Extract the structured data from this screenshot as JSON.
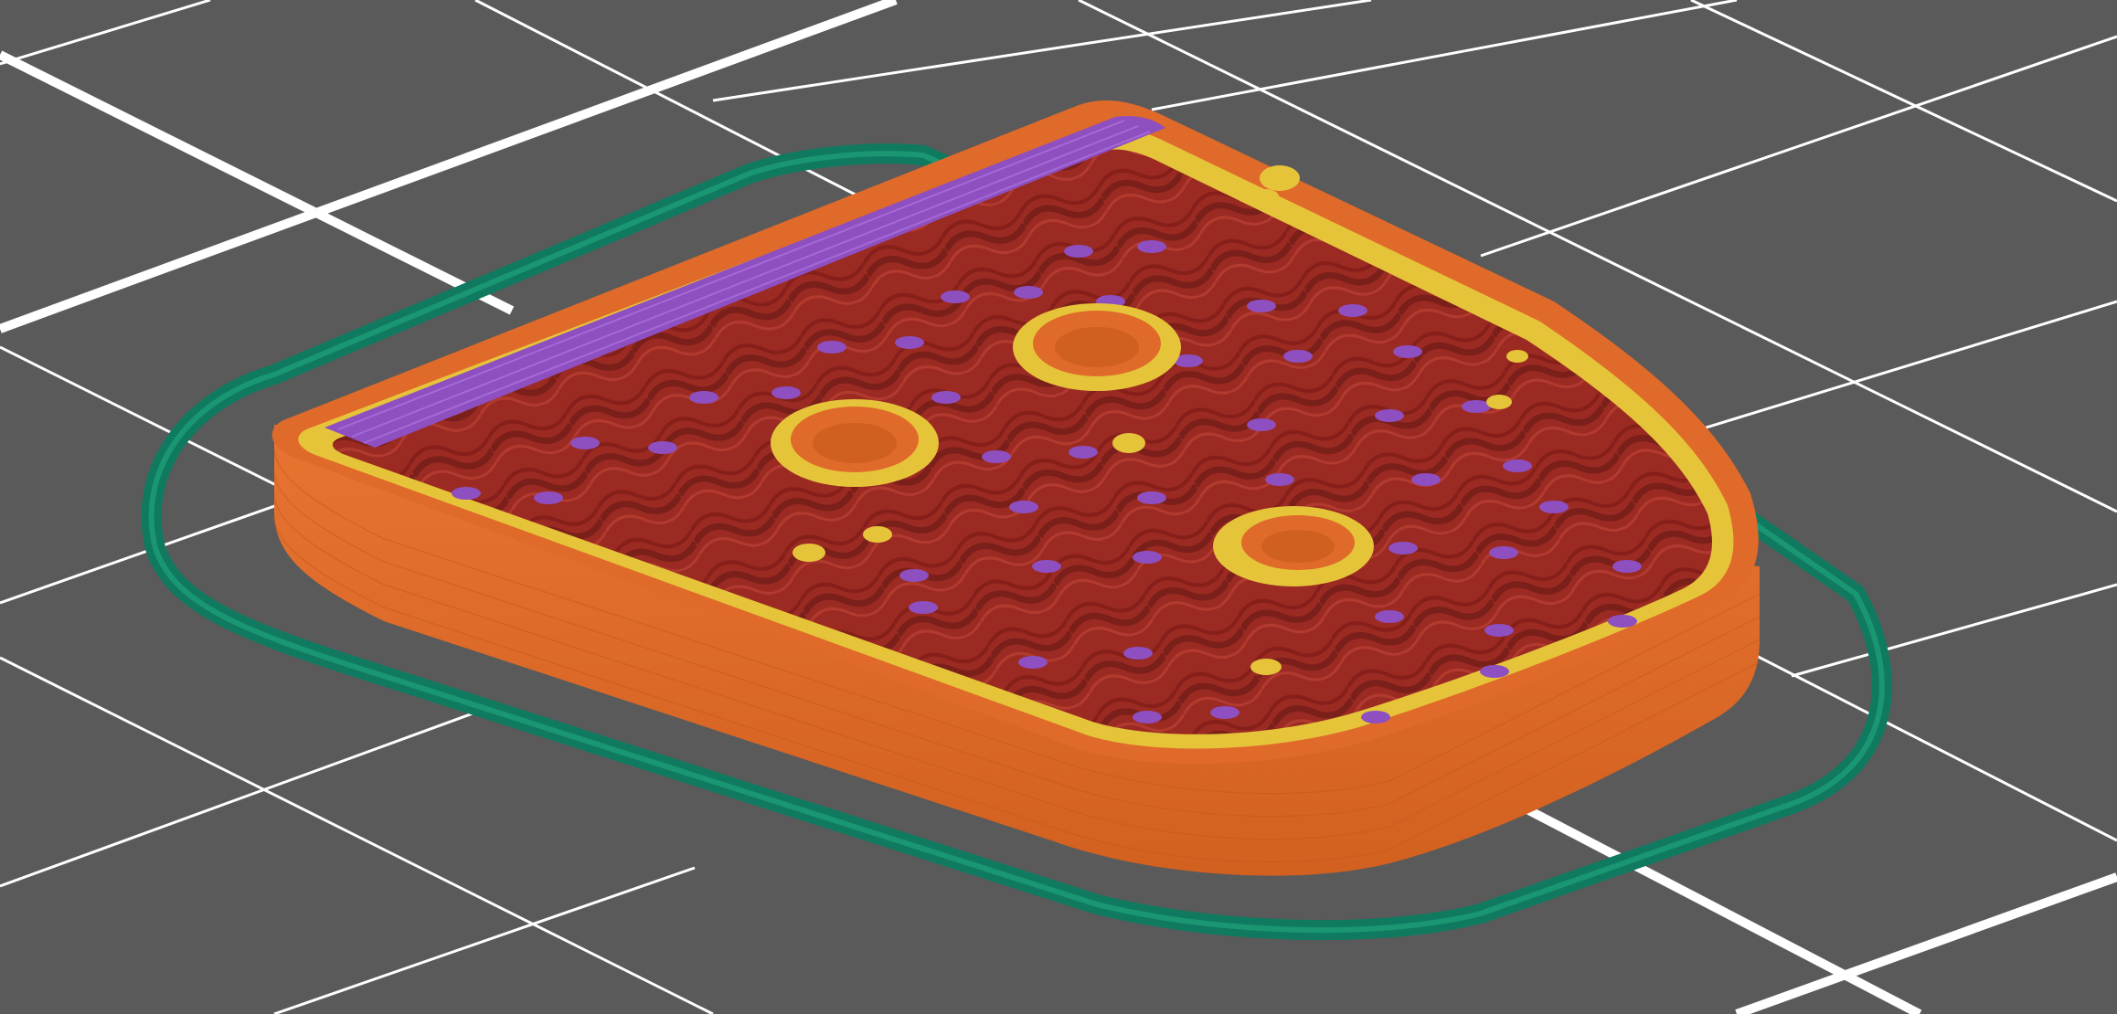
{
  "viewport": {
    "view": "3d-layer-preview",
    "background_color": "#5a5a5a",
    "grid_color": "#ffffff",
    "grid_visible": true
  },
  "model": {
    "colors": {
      "skirt": "#0f7a5f",
      "outer_wall": "#e06a2a",
      "inner_wall": "#e6c43a",
      "sparse_infill": "#9b2a22",
      "solid_infill": "#8e4fc1"
    },
    "holes": 3
  }
}
